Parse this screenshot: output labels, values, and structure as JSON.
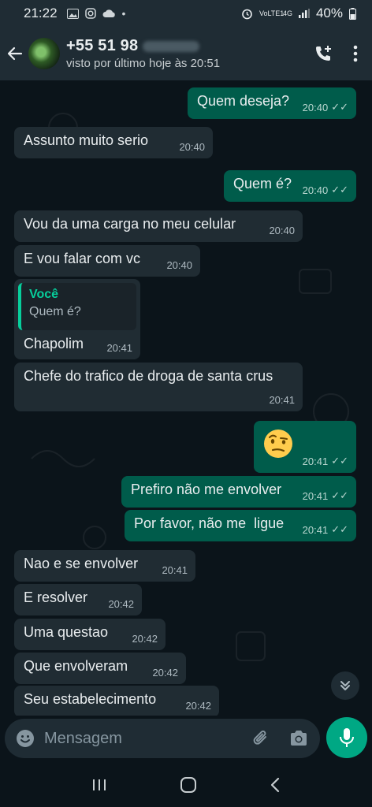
{
  "status_bar": {
    "time": "21:22",
    "battery": "40%",
    "network": "4G",
    "carrier": "VoLTE1"
  },
  "header": {
    "contact_name": "+55 51 98",
    "last_seen": "visto por último hoje às 20:51"
  },
  "messages": [
    {
      "dir": "out",
      "text": "Quem deseja?",
      "time": "20:40"
    },
    {
      "dir": "in",
      "text": "Assunto muito serio",
      "time": "20:40"
    },
    {
      "dir": "out",
      "text": "Quem é?",
      "time": "20:40"
    },
    {
      "dir": "in",
      "text": "Vou da uma carga no meu celular",
      "time": "20:40"
    },
    {
      "dir": "in",
      "text": "E vou falar com vc",
      "time": "20:40"
    },
    {
      "dir": "in",
      "text": "Chapolim",
      "time": "20:41",
      "quote": {
        "author": "Você",
        "text": "Quem é?"
      }
    },
    {
      "dir": "in",
      "text": "Chefe do trafico de droga de santa crus",
      "time": "20:41"
    },
    {
      "dir": "out",
      "text": "🤨",
      "time": "20:41",
      "emoji": "raised-eyebrow-face"
    },
    {
      "dir": "out",
      "text": "Prefiro não me envolver",
      "time": "20:41"
    },
    {
      "dir": "out",
      "text": "Por favor, não me  ligue",
      "time": "20:41"
    },
    {
      "dir": "in",
      "text": "Nao e se envolver",
      "time": "20:41"
    },
    {
      "dir": "in",
      "text": "E resolver",
      "time": "20:42"
    },
    {
      "dir": "in",
      "text": "Uma questao",
      "time": "20:42"
    },
    {
      "dir": "in",
      "text": "Que envolveram",
      "time": "20:42"
    },
    {
      "dir": "in",
      "text": "Seu estabelecimento",
      "time": "20:42"
    }
  ],
  "composer": {
    "placeholder": "Mensagem"
  },
  "colors": {
    "incoming_bubble": "#202c33",
    "outgoing_bubble": "#005c4b",
    "accent": "#00a884",
    "background": "#0b141a"
  }
}
